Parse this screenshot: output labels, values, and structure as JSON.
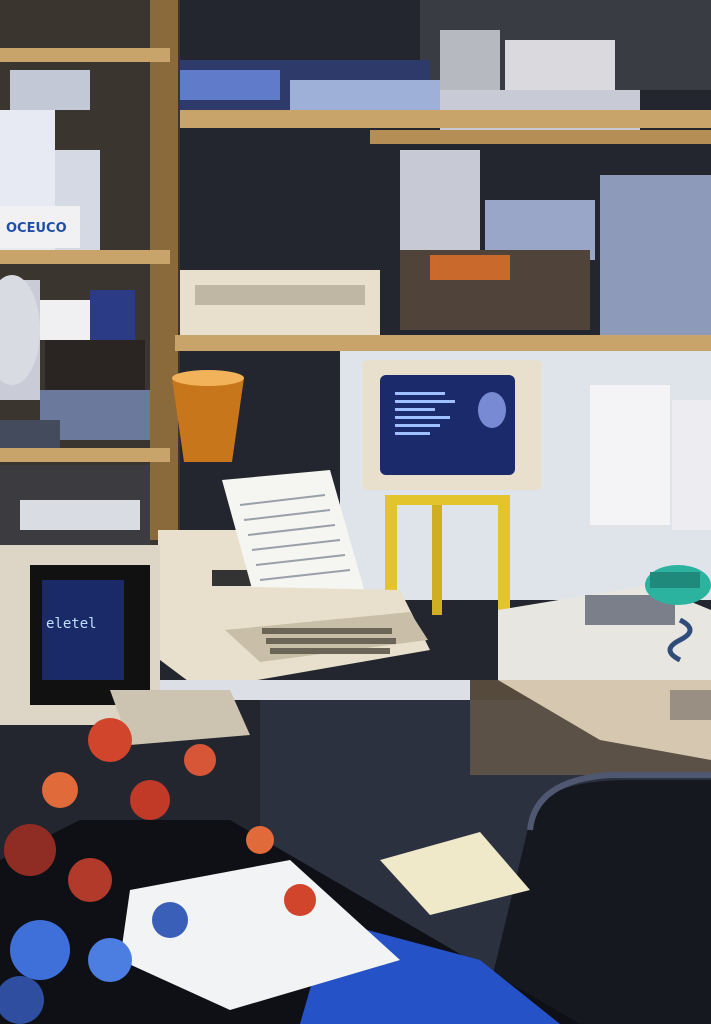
{
  "scene": {
    "box_label": "OCEUCO",
    "small_monitor_text": "eletel",
    "colors": {
      "wall": "#2a2d35",
      "shelf_wood": "#c9a46a",
      "shelf_edge": "#8a6a3a",
      "beige_plastic": "#e8e0cc",
      "screen_blue": "#1b2a6b",
      "lamp_copper": "#c8761c",
      "chair_black": "#15181f",
      "desk_blue": "#2552c7",
      "phone_green": "#2bb3a0",
      "flower_red": "#d1452c",
      "flower_blue": "#3f6fd8",
      "yellow_frame": "#e4c42c"
    }
  }
}
